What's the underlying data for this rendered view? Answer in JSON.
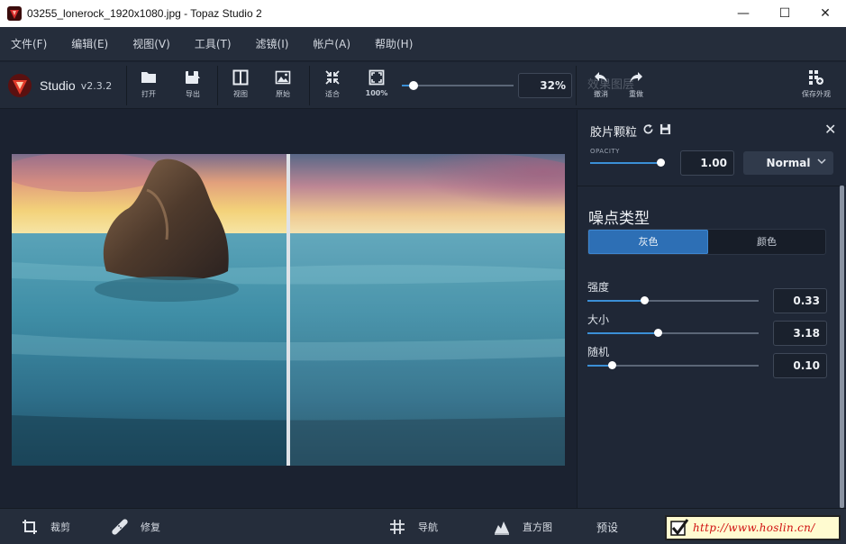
{
  "window": {
    "title": "03255_lonerock_1920x1080.jpg - Topaz Studio 2",
    "minimize": "—",
    "maximize": "☐",
    "close": "✕"
  },
  "menu": [
    "文件(F)",
    "编辑(E)",
    "视图(V)",
    "工具(T)",
    "滤镜(I)",
    "帐户(A)",
    "帮助(H)"
  ],
  "app": {
    "name": "Studio",
    "version": "v2.3.2"
  },
  "toolbar": {
    "open": "打开",
    "export": "导出",
    "view": "视图",
    "original": "原始",
    "fit": "适合",
    "hundred": "100%",
    "zoom_value": "32%",
    "zoom_fraction": 0.1,
    "undo": "撤消",
    "redo": "重做",
    "save_look": "保存外观",
    "ghost_text": "效果图层"
  },
  "panel": {
    "title": "胶片颗粒",
    "opacity_label": "OPACITY",
    "opacity_value": "1.00",
    "opacity_fraction": 1.0,
    "blend_mode": "Normal",
    "section_title": "噪点类型",
    "noise_types": [
      "灰色",
      "颜色"
    ],
    "active_noise_type": 0,
    "params": [
      {
        "label": "强度",
        "value": "0.33",
        "fraction": 0.33
      },
      {
        "label": "大小",
        "value": "3.18",
        "fraction": 0.41
      },
      {
        "label": "随机",
        "value": "0.10",
        "fraction": 0.14
      }
    ]
  },
  "bottom": {
    "crop": "裁剪",
    "repair": "修复",
    "navigate": "导航",
    "histogram": "直方图",
    "presets": "预设",
    "watermark": "http://www.hoslin.cn/"
  },
  "colors": {
    "accent": "#3b8fd6",
    "panel_bg": "#1f2736",
    "active_segment": "#2d6fb5"
  }
}
